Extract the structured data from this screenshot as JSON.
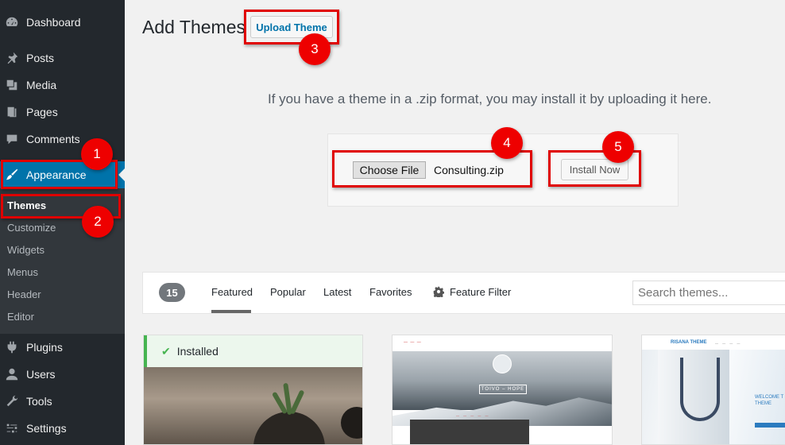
{
  "sidebar": {
    "items": [
      {
        "label": "Dashboard",
        "icon": "dashboard-icon"
      },
      {
        "label": "Posts",
        "icon": "pushpin-icon"
      },
      {
        "label": "Media",
        "icon": "media-icon"
      },
      {
        "label": "Pages",
        "icon": "pages-icon"
      },
      {
        "label": "Comments",
        "icon": "comment-icon"
      },
      {
        "label": "Appearance",
        "icon": "paintbrush-icon",
        "current": true
      },
      {
        "label": "Plugins",
        "icon": "plugin-icon"
      },
      {
        "label": "Users",
        "icon": "user-icon"
      },
      {
        "label": "Tools",
        "icon": "wrench-icon"
      },
      {
        "label": "Settings",
        "icon": "settings-icon"
      }
    ],
    "appearance_submenu": [
      "Themes",
      "Customize",
      "Widgets",
      "Menus",
      "Header",
      "Editor"
    ],
    "active_submenu": "Themes"
  },
  "header": {
    "title": "Add Themes",
    "upload_button": "Upload Theme"
  },
  "upload": {
    "help_text": "If you have a theme in a .zip format, you may install it by uploading it here.",
    "choose_file_label": "Choose File",
    "file_name": "Consulting.zip",
    "install_button": "Install Now"
  },
  "annotations": [
    "1",
    "2",
    "3",
    "4",
    "5"
  ],
  "filter_bar": {
    "count": "15",
    "tabs": [
      "Featured",
      "Popular",
      "Latest",
      "Favorites"
    ],
    "active_tab": "Featured",
    "feature_filter": "Feature Filter",
    "search_placeholder": "Search themes..."
  },
  "themes": [
    {
      "status": "Installed"
    },
    {
      "preview_title": "TOIVO – HOPE"
    },
    {
      "preview_brand": "RISANA THEME",
      "preview_heading": "WELCOME T THEME"
    }
  ],
  "colors": {
    "sidebar_bg": "#23282d",
    "submenu_bg": "#32373c",
    "accent": "#0073aa",
    "annotation_red": "#ee0000",
    "installed_green": "#46b450"
  }
}
